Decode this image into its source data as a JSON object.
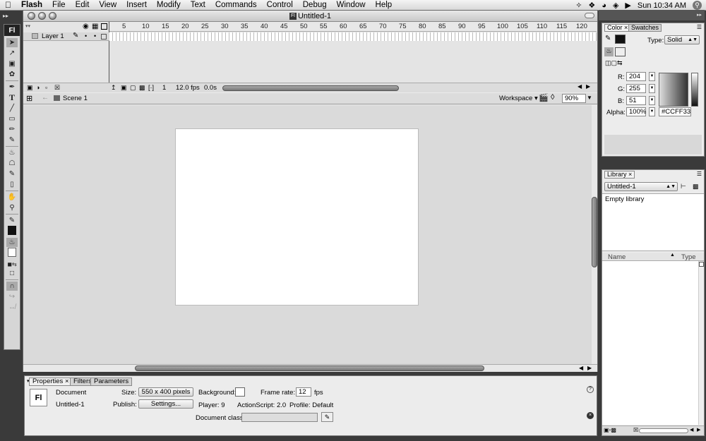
{
  "menubar": {
    "items": [
      "Flash",
      "File",
      "Edit",
      "View",
      "Insert",
      "Modify",
      "Text",
      "Commands",
      "Control",
      "Debug",
      "Window",
      "Help"
    ],
    "clock": "Sun 10:34 AM"
  },
  "document": {
    "title": "Untitled-1"
  },
  "timeline": {
    "layer_name": "Layer 1",
    "ruler_ticks": [
      "5",
      "10",
      "15",
      "20",
      "25",
      "30",
      "35",
      "40",
      "45",
      "50",
      "55",
      "60",
      "65",
      "70",
      "75",
      "80",
      "85",
      "90",
      "95",
      "100",
      "105",
      "110",
      "115",
      "120"
    ],
    "current_frame": "1",
    "fps": "12.0 fps",
    "time": "0.0s"
  },
  "scene": {
    "name": "Scene 1",
    "workspace_label": "Workspace ▾",
    "zoom": "90%"
  },
  "properties": {
    "tabs": [
      "Properties",
      "Filters",
      "Parameters"
    ],
    "doc_label": "Document",
    "doc_name": "Untitled-1",
    "size_label": "Size:",
    "size_value": "550 x 400 pixels",
    "publish_label": "Publish:",
    "settings_button": "Settings...",
    "background_label": "Background:",
    "framerate_label": "Frame rate:",
    "framerate_value": "12",
    "fps_unit": "fps",
    "player": "Player: 9",
    "actionscript": "ActionScript: 2.0",
    "profile": "Profile:  Default",
    "docclass_label": "Document class:",
    "fl_logo": "Fl"
  },
  "color_panel": {
    "tabs": [
      "Color",
      "Swatches"
    ],
    "type_label": "Type:",
    "type_value": "Solid",
    "r_label": "R:",
    "r_value": "204",
    "g_label": "G:",
    "g_value": "255",
    "b_label": "B:",
    "b_value": "51",
    "alpha_label": "Alpha:",
    "alpha_value": "100%",
    "hex_value": "#CCFF33"
  },
  "library_panel": {
    "tab": "Library",
    "doc_select": "Untitled-1",
    "empty_text": "Empty library",
    "col_name": "Name",
    "col_type": "Type"
  },
  "toolbar": {
    "logo": "Fl"
  }
}
